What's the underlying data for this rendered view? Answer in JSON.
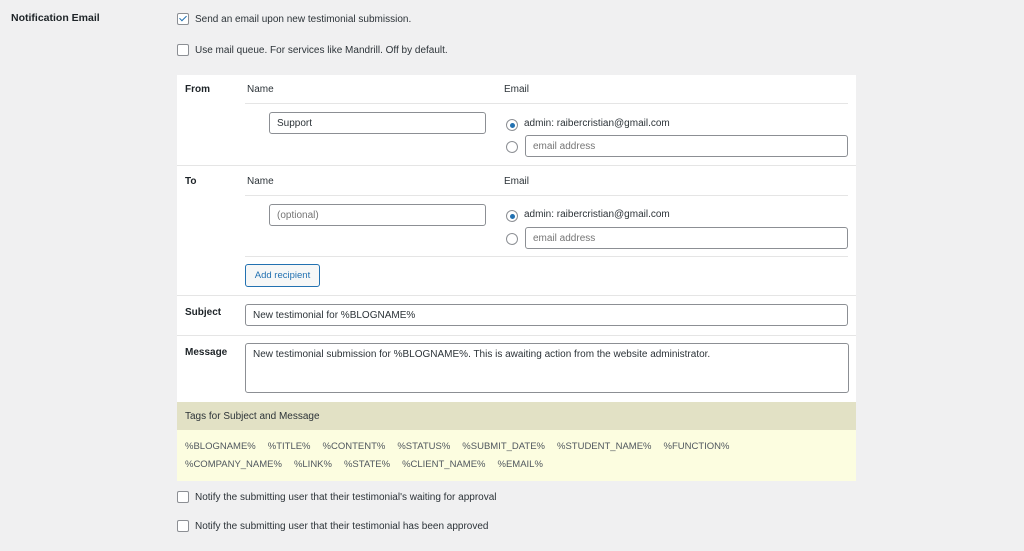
{
  "section_label": "Notification Email",
  "checkbox_send": {
    "label": "Send an email upon new testimonial submission.",
    "checked": true
  },
  "checkbox_queue": {
    "label": "Use mail queue. For services like Mandrill. Off by default.",
    "checked": false
  },
  "from": {
    "label": "From",
    "name_header": "Name",
    "email_header": "Email",
    "name_value": "Support",
    "admin_option": "admin:  raibercristian@gmail.com",
    "email_placeholder": "email address"
  },
  "to": {
    "label": "To",
    "name_header": "Name",
    "email_header": "Email",
    "name_placeholder": "(optional)",
    "admin_option": "admin:  raibercristian@gmail.com",
    "email_placeholder": "email address",
    "add_recipient": "Add recipient"
  },
  "subject": {
    "label": "Subject",
    "value": "New testimonial for %BLOGNAME%"
  },
  "message": {
    "label": "Message",
    "value": "New testimonial submission for %BLOGNAME%. This is awaiting action from the website administrator."
  },
  "tags": {
    "header": "Tags for Subject and Message",
    "row1": [
      "%BLOGNAME%",
      "%TITLE%",
      "%CONTENT%",
      "%STATUS%",
      "%SUBMIT_DATE%",
      "%STUDENT_NAME%",
      "%FUNCTION%"
    ],
    "row2": [
      "%COMPANY_NAME%",
      "%LINK%",
      "%STATE%",
      "%CLIENT_NAME%",
      "%EMAIL%"
    ]
  },
  "checkbox_waiting": {
    "label": "Notify the submitting user that their testimonial's waiting for approval",
    "checked": false
  },
  "checkbox_approved": {
    "label": "Notify the submitting user that their testimonial has been approved",
    "checked": false
  },
  "colors": {
    "accent": "#2271b1",
    "tags_header_bg": "#e2e1c5",
    "tags_body_bg": "#fcfde0"
  }
}
